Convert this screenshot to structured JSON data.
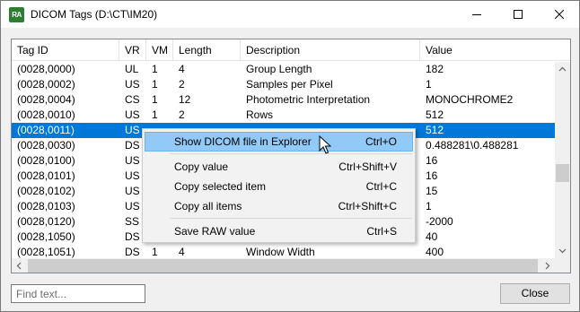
{
  "window": {
    "title": "DICOM Tags (D:\\CT\\IM20)",
    "icon_label": "RA"
  },
  "titlebar_buttons": [
    "minimize-icon",
    "maximize-icon",
    "close-icon"
  ],
  "table": {
    "columns": [
      "Tag ID",
      "VR",
      "VM",
      "Length",
      "Description",
      "Value"
    ],
    "rows": [
      [
        "(0028,0000)",
        "UL",
        "1",
        "4",
        "Group Length",
        "182"
      ],
      [
        "(0028,0002)",
        "US",
        "1",
        "2",
        "Samples per Pixel",
        "1"
      ],
      [
        "(0028,0004)",
        "CS",
        "1",
        "12",
        "Photometric Interpretation",
        "MONOCHROME2"
      ],
      [
        "(0028,0010)",
        "US",
        "1",
        "2",
        "Rows",
        "512"
      ],
      [
        "(0028,0011)",
        "US",
        "",
        "",
        "",
        "512"
      ],
      [
        "(0028,0030)",
        "DS",
        "",
        "",
        "",
        "0.488281\\0.488281"
      ],
      [
        "(0028,0100)",
        "US",
        "",
        "",
        "",
        "16"
      ],
      [
        "(0028,0101)",
        "US",
        "",
        "",
        "",
        "16"
      ],
      [
        "(0028,0102)",
        "US",
        "",
        "",
        "",
        "15"
      ],
      [
        "(0028,0103)",
        "US",
        "",
        "",
        "",
        "1"
      ],
      [
        "(0028,0120)",
        "SS",
        "",
        "",
        "",
        "-2000"
      ],
      [
        "(0028,1050)",
        "DS",
        "",
        "",
        "",
        "40"
      ],
      [
        "(0028,1051)",
        "DS",
        "1",
        "4",
        "Window Width",
        "400"
      ]
    ],
    "selected_row": 4
  },
  "context_menu": {
    "items": [
      {
        "label": "Show DICOM file in Explorer",
        "shortcut": "Ctrl+O"
      },
      {
        "label": "Copy value",
        "shortcut": "Ctrl+Shift+V"
      },
      {
        "label": "Copy selected item",
        "shortcut": "Ctrl+C"
      },
      {
        "label": "Copy all items",
        "shortcut": "Ctrl+Shift+C"
      },
      {
        "label": "Save RAW value",
        "shortcut": "Ctrl+S"
      }
    ],
    "hovered_index": 0
  },
  "footer": {
    "find_placeholder": "Find text...",
    "find_value": "",
    "close_label": "Close"
  },
  "colors": {
    "selection": "#0078d7",
    "menu_hover": "#91c9f7"
  }
}
